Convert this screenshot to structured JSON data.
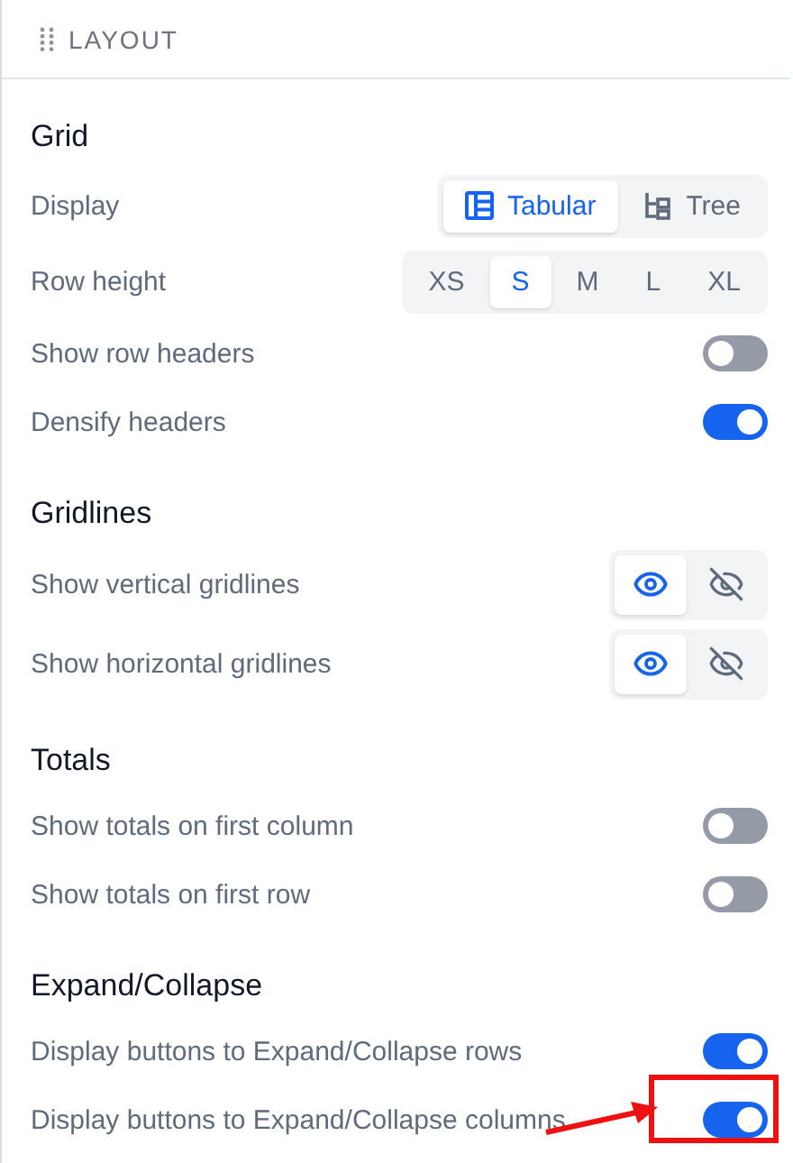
{
  "panel": {
    "title": "LAYOUT"
  },
  "sections": [
    {
      "title": "Grid",
      "rows": [
        {
          "kind": "segmented",
          "label": "Display",
          "options": [
            {
              "label": "Tabular",
              "selected": true
            },
            {
              "label": "Tree",
              "selected": false
            }
          ]
        },
        {
          "kind": "segmented",
          "label": "Row height",
          "options": [
            {
              "label": "XS",
              "selected": false
            },
            {
              "label": "S",
              "selected": true
            },
            {
              "label": "M",
              "selected": false
            },
            {
              "label": "L",
              "selected": false
            },
            {
              "label": "XL",
              "selected": false
            }
          ]
        },
        {
          "kind": "toggle",
          "label": "Show row headers",
          "on": false
        },
        {
          "kind": "toggle",
          "label": "Densify headers",
          "on": true
        }
      ]
    },
    {
      "title": "Gridlines",
      "rows": [
        {
          "kind": "visibility",
          "label": "Show vertical gridlines",
          "options": [
            {
              "selected": true
            },
            {
              "selected": false
            }
          ]
        },
        {
          "kind": "visibility",
          "label": "Show horizontal gridlines",
          "options": [
            {
              "selected": true
            },
            {
              "selected": false
            }
          ]
        }
      ]
    },
    {
      "title": "Totals",
      "rows": [
        {
          "kind": "toggle",
          "label": "Show totals on first column",
          "on": false
        },
        {
          "kind": "toggle",
          "label": "Show totals on first row",
          "on": false
        }
      ]
    },
    {
      "title": "Expand/Collapse",
      "rows": [
        {
          "kind": "toggle",
          "label": "Display buttons to Expand/Collapse rows",
          "on": true
        },
        {
          "kind": "toggle",
          "label": "Display buttons to Expand/Collapse columns",
          "on": true,
          "highlighted": true
        }
      ]
    }
  ]
}
